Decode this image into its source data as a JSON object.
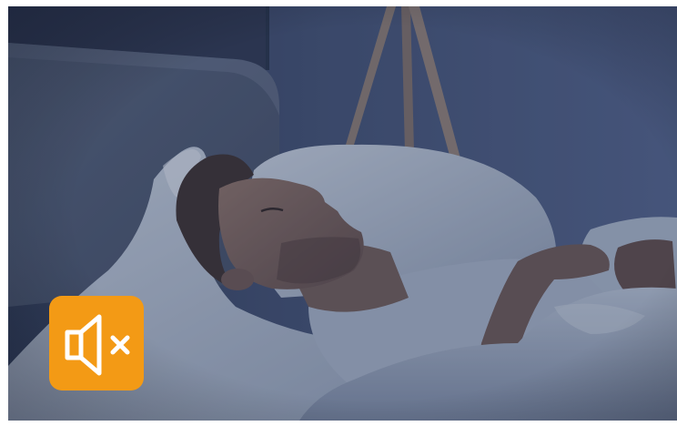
{
  "video": {
    "scene": "person-sleeping-in-bed",
    "muted": true
  },
  "mute_button": {
    "icon": "speaker-muted-icon",
    "color": "#f39a15",
    "icon_color": "#ffffff"
  },
  "colors": {
    "wall": "#46557a",
    "bedding": "#a9b7cc",
    "overlay": "#2a3652"
  }
}
